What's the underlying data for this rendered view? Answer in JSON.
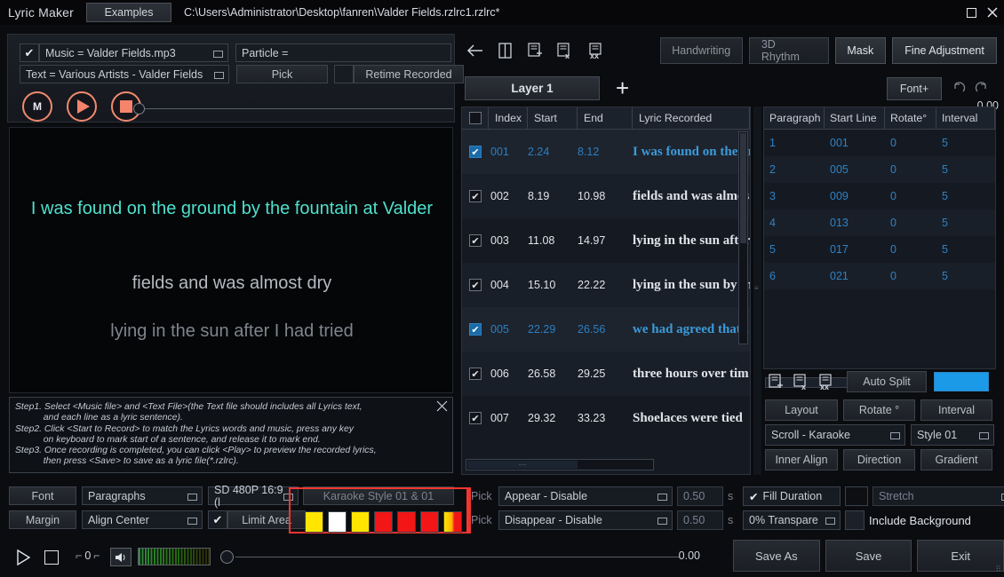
{
  "window": {
    "app_title": "Lyric Maker",
    "examples_label": "Examples",
    "file_path": "C:\\Users\\Administrator\\Desktop\\fanren\\Valder Fields.rzlrc1.rzlrc*",
    "maximize_icon": "maximize-icon",
    "close_icon": "close-icon"
  },
  "source": {
    "music_checkbox": "✔",
    "music_field": "Music = Valder Fields.mp3",
    "particle_field": "Particle =",
    "text_field": "Text = Various Artists - Valder Fields",
    "pick_label": "Pick",
    "retime_checkbox": "",
    "retime_label": "Retime Recorded"
  },
  "transport_top": {
    "mark_label": "M",
    "play_icon": "play-icon",
    "stop_icon": "stop-icon",
    "seek_value": "0.00"
  },
  "preview": {
    "line1": "I was found on the ground by the fountain at Valder",
    "line2": "fields and was almost dry",
    "line3": "lying in the sun after I had tried",
    "line1_color": "#4fe0cd",
    "line2_color": "#b6bac0",
    "line3_color": "#80858c"
  },
  "steps": {
    "close_icon": "✕",
    "lines": [
      "Step1. Select <Music file> and <Text File>(the Text file should includes all Lyrics text,",
      "           and each line as a lyric sentence).",
      "Step2. Click <Start to Record> to match the Lyrics words and music, press any key",
      "           on keyboard to mark start of a sentence, and release it to mark end.",
      "Step3. Once recording is completed, you can click <Play> to preview the recorded lyrics,",
      "           then press <Save> to save as a lyric file(*.rzlrc)."
    ]
  },
  "bottom_left": {
    "font_label": "Font",
    "paragraphs_label": "Paragraphs",
    "resolution_label": "SD 480P 16:9 (l",
    "karaoke_style_label": "Karaoke Style 01 & 01",
    "pick1_label": "Pick",
    "margin_label": "Margin",
    "align_label": "Align Center",
    "limit_checkbox": "✔",
    "limit_label": "Limit Area",
    "pick2_label": "Pick",
    "highlight_color": "#f2362f",
    "swatches": [
      "#ffe500",
      "#ffffff",
      "#ffe500",
      "#f21616",
      "#f21616",
      "#f21616",
      "gradient-yellow-red"
    ]
  },
  "transport_bottom": {
    "play_icon": "play-outline-icon",
    "stop_icon": "stop-outline-icon",
    "loop_value": "0",
    "speaker_icon": "speaker-icon",
    "vu_meter": "vu-meter",
    "volume_knob": "volume-knob",
    "time_value": "0.00"
  },
  "center_toolbar": {
    "back_icon": "back-arrow-icon",
    "page_icon": "page-icon",
    "add_line_icon": "add-line-icon",
    "delete_line_icon": "delete-line-icon",
    "delete-all_icon": "delete-all-lines-icon",
    "buttons": [
      {
        "label": "Handwriting",
        "active": false
      },
      {
        "label": "3D Rhythm",
        "active": false
      },
      {
        "label": "Mask",
        "active": true
      },
      {
        "label": "Fine Adjustment",
        "active": true
      }
    ]
  },
  "layer_bar": {
    "layer_label": "Layer 1",
    "add_layer_icon": "plus-icon",
    "font_plus_label": "Font+",
    "undo_icon": "undo-icon",
    "redo_icon": "redo-icon"
  },
  "lyric_table": {
    "select_all_checkbox": "",
    "headers": [
      "Index",
      "Start",
      "End",
      "Lyric Recorded"
    ],
    "rows": [
      {
        "checked": "✔",
        "index": "001",
        "start": "2.24",
        "end": "8.12",
        "lyric": "I was found on the gr",
        "selected": true
      },
      {
        "checked": "✔",
        "index": "002",
        "start": "8.19",
        "end": "10.98",
        "lyric": "fields and was almos",
        "selected": false
      },
      {
        "checked": "✔",
        "index": "003",
        "start": "11.08",
        "end": "14.97",
        "lyric": "lying in the sun after",
        "selected": false
      },
      {
        "checked": "✔",
        "index": "004",
        "start": "15.10",
        "end": "22.22",
        "lyric": "lying in the sun by th",
        "selected": false
      },
      {
        "checked": "✔",
        "index": "005",
        "start": "22.29",
        "end": "26.56",
        "lyric": "we had agreed that t",
        "selected": true
      },
      {
        "checked": "✔",
        "index": "006",
        "start": "26.58",
        "end": "29.25",
        "lyric": "three hours over tim",
        "selected": false
      },
      {
        "checked": "✔",
        "index": "007",
        "start": "29.32",
        "end": "33.23",
        "lyric": "Shoelaces were tied",
        "selected": false
      }
    ]
  },
  "paragraph_table": {
    "headers": [
      "Paragraph",
      "Start Line",
      "Rotate°",
      "Interval"
    ],
    "rows": [
      {
        "paragraph": "1",
        "start_line": "001",
        "rotate": "0",
        "interval": "5"
      },
      {
        "paragraph": "2",
        "start_line": "005",
        "rotate": "0",
        "interval": "5"
      },
      {
        "paragraph": "3",
        "start_line": "009",
        "rotate": "0",
        "interval": "5"
      },
      {
        "paragraph": "4",
        "start_line": "013",
        "rotate": "0",
        "interval": "5"
      },
      {
        "paragraph": "5",
        "start_line": "017",
        "rotate": "0",
        "interval": "5"
      },
      {
        "paragraph": "6",
        "start_line": "021",
        "rotate": "0",
        "interval": "5"
      }
    ]
  },
  "right_tools": {
    "add_paragraph_icon": "add-paragraph-icon",
    "delete_paragraph_icon": "delete-paragraph-icon",
    "delete_all_paragraph_icon": "delete-all-paragraphs-icon",
    "auto_split_label": "Auto Split",
    "color_swatch": "#1b9ae8",
    "layout_label": "Layout",
    "rotate_label": "Rotate °",
    "interval_label": "Interval",
    "scroll_mode": "Scroll - Karaoke",
    "style_value": "Style 01",
    "inner_align_label": "Inner Align",
    "direction_label": "Direction",
    "gradient_label": "Gradient"
  },
  "bottom_right": {
    "pick1_label": "Pick",
    "appear_value": "Appear - Disable",
    "appear_time": "0.50",
    "appear_unit": "s",
    "fill_checkbox": "✔",
    "fill_label": "Fill Duration",
    "fill_color": "#0d0f13",
    "stretch_label": "Stretch",
    "pick2_label": "Pick",
    "disappear_value": "Disappear - Disable",
    "disappear_time": "0.50",
    "disappear_unit": "s",
    "transparency_value": "0% Transpare",
    "include_bg_checkbox": "",
    "include_bg_label": "Include Background",
    "save_as_label": "Save As",
    "save_label": "Save",
    "exit_label": "Exit"
  }
}
